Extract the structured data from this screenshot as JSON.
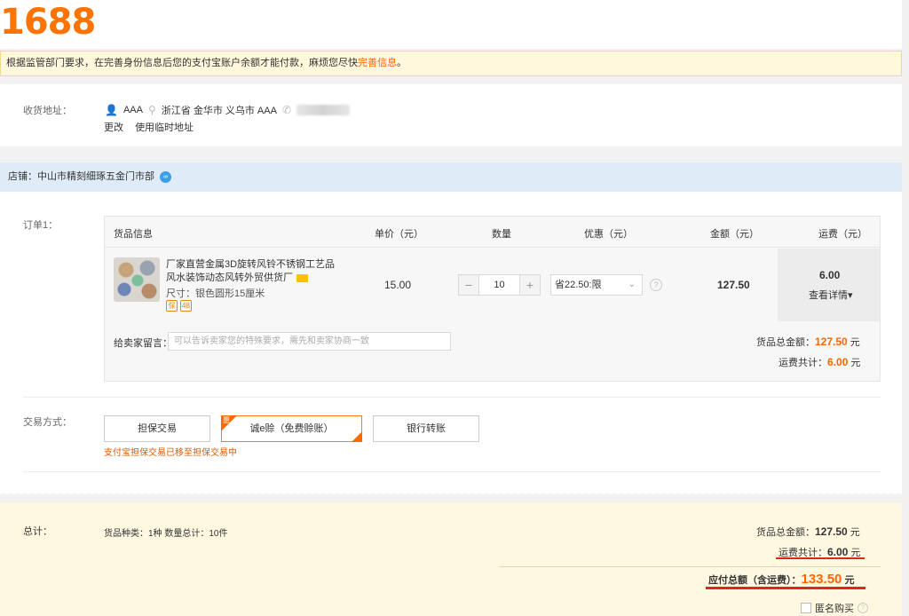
{
  "logo": "1688",
  "notice": {
    "text": "根据监管部门要求，在完善身份信息后您的支付宝账户余额才能付款，麻烦您尽快",
    "link": "完善信息",
    "tail": "。"
  },
  "address": {
    "label": "收货地址：",
    "name": "AAA",
    "location": "浙江省 金华市 义乌市 AAA",
    "actions": [
      "更改",
      "使用临时地址"
    ]
  },
  "store": {
    "label": "店铺：中山市精刻细琢五金门市部"
  },
  "order": {
    "label": "订单1：",
    "headers": [
      "货品信息",
      "单价（元）",
      "数量",
      "优惠（元）",
      "金额（元）",
      "运费（元）"
    ],
    "product": {
      "name": "厂家直营金属3D旋转风铃不锈钢工艺品风水装饰动态风转外贸供货厂",
      "spec": "尺寸：银色圆形15厘米",
      "badges": [
        "保",
        "48"
      ],
      "unit_price": "15.00",
      "quantity": "10",
      "discount": "省22.50:限",
      "amount": "127.50",
      "shipping": "6.00",
      "shipping_detail": "查看详情▾"
    },
    "message_label": "给卖家留言：",
    "message_placeholder": "可以告诉卖家您的特殊要求，需先和卖家协商一致",
    "goods_total_label": "货品总金额：",
    "goods_total": "127.50",
    "shipping_total_label": "运费共计：",
    "shipping_total": "6.00",
    "currency": "元"
  },
  "payment": {
    "label": "交易方式：",
    "options": [
      "担保交易",
      "诚e赊（免费赊账）",
      "银行转账"
    ],
    "promo_tag": "惠",
    "note": "支付宝担保交易已移至担保交易中"
  },
  "total": {
    "label": "总计：",
    "info": "货品种类：1种   数量总计：10件",
    "goods_total_label": "货品总金额：",
    "goods_total": "127.50",
    "shipping_label": "运费共计：",
    "shipping": "6.00",
    "payable_label": "应付总额（含运费）：",
    "payable": "133.50",
    "currency": "元",
    "anonymous": "匿名购买"
  },
  "colors": {
    "brand": "#ff7300",
    "accent": "#ff6600",
    "red_underline": "#e1251b"
  }
}
